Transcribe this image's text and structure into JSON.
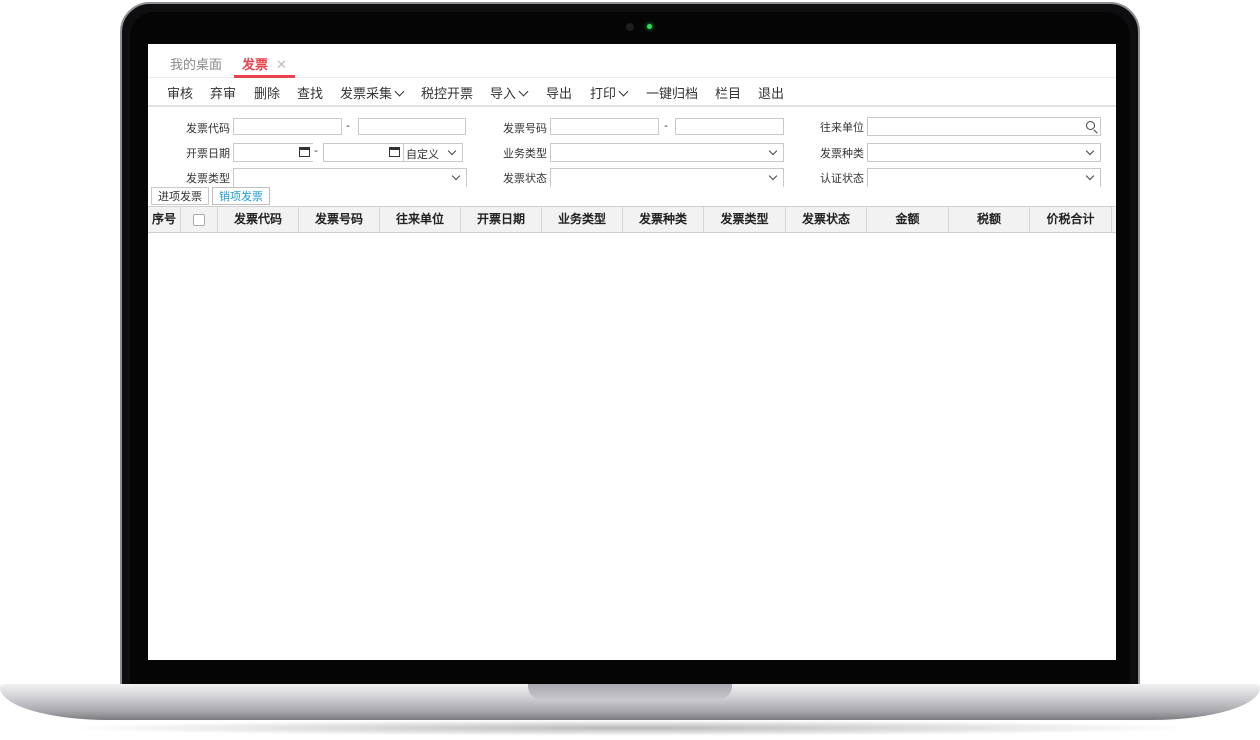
{
  "tabs": {
    "desktop": "我的桌面",
    "invoice": "发票",
    "close": "✕"
  },
  "toolbar": {
    "audit": "审核",
    "unaudit": "弃审",
    "delete": "删除",
    "find": "查找",
    "collect": "发票采集",
    "tax_control": "税控开票",
    "import": "导入",
    "export": "导出",
    "print": "打印",
    "archive": "一键归档",
    "columns": "栏目",
    "exit": "退出"
  },
  "filters": {
    "invoice_code": "发票代码",
    "invoice_number": "发票号码",
    "partner": "往来单位",
    "issue_date": "开票日期",
    "business_type": "业务类型",
    "invoice_kind": "发票种类",
    "invoice_type": "发票类型",
    "invoice_status": "发票状态",
    "cert_status": "认证状态",
    "date_range": "自定义",
    "dash": "-"
  },
  "subtabs": {
    "input": "进项发票",
    "output": "销项发票"
  },
  "grid": {
    "columns": [
      "序号",
      "",
      "发票代码",
      "发票号码",
      "往来单位",
      "开票日期",
      "业务类型",
      "发票种类",
      "发票类型",
      "发票状态",
      "金额",
      "税额",
      "价税合计"
    ]
  },
  "colors": {
    "accent": "#e8434e",
    "link": "#1e9bd7"
  }
}
